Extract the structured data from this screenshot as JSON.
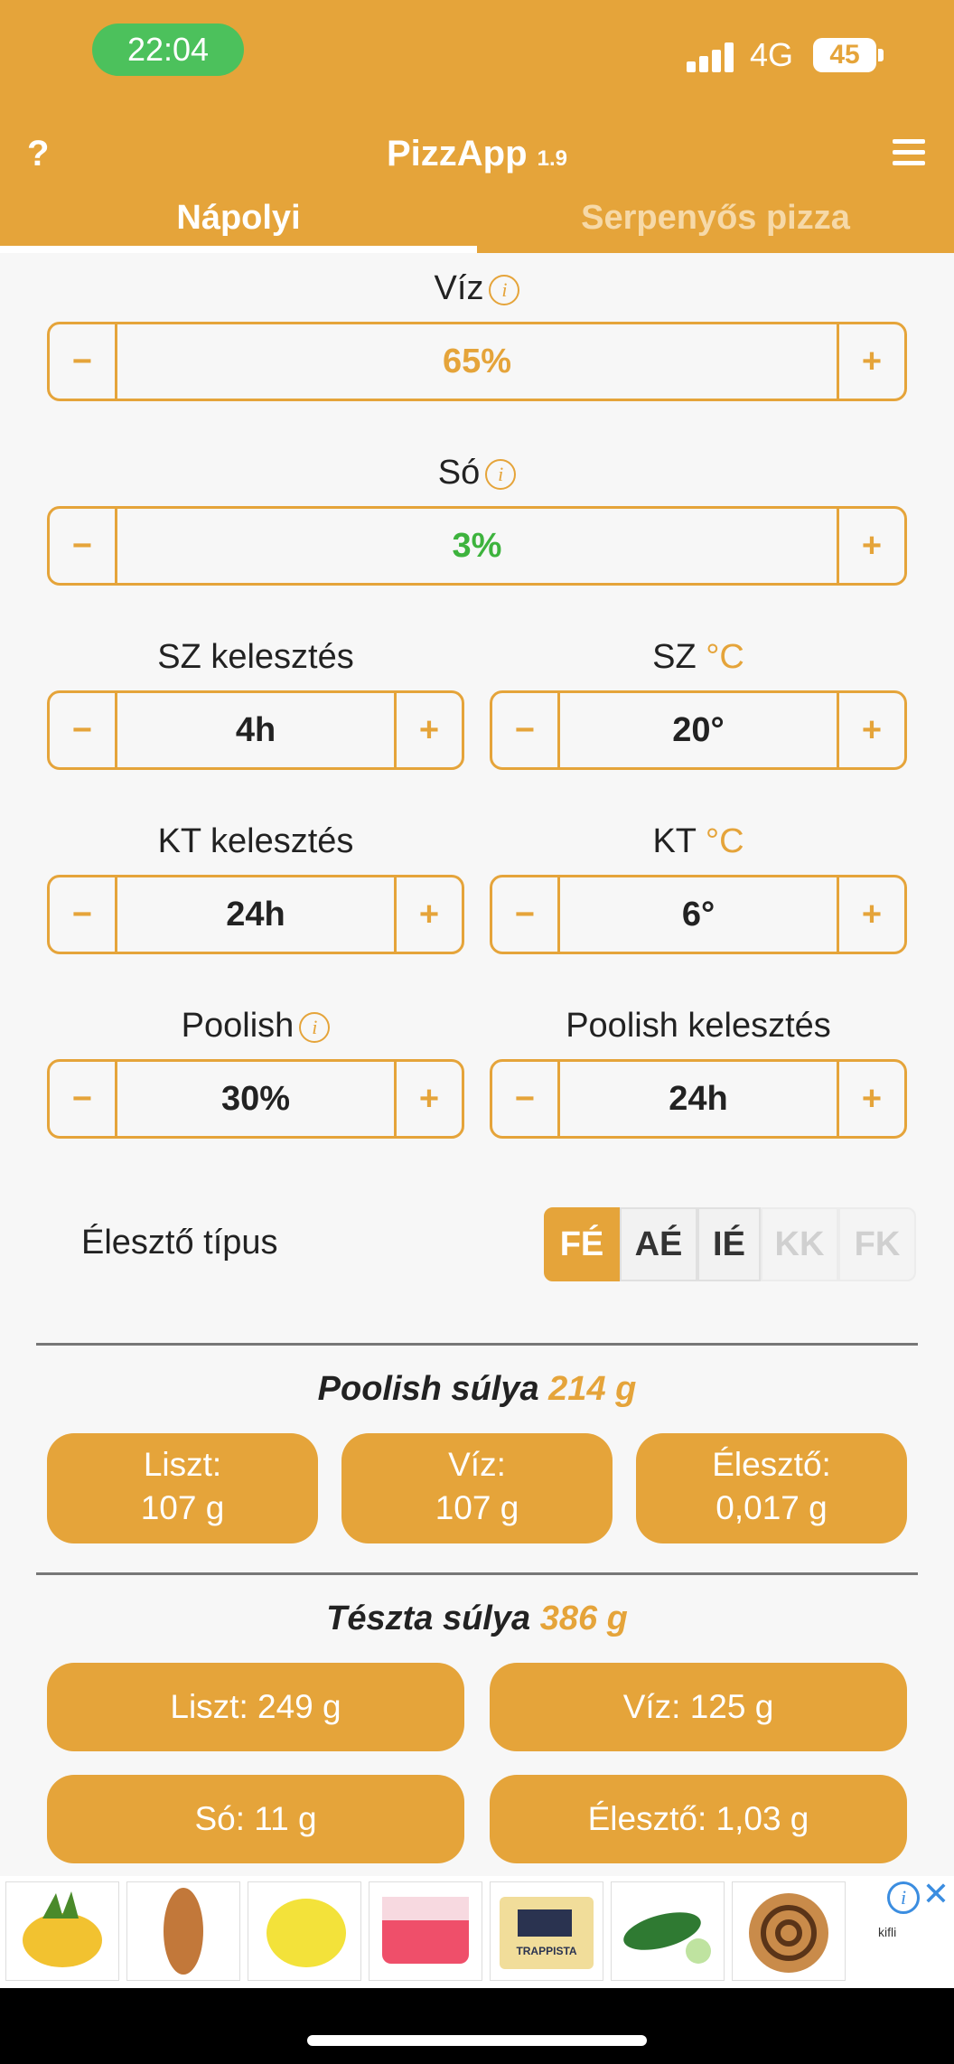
{
  "status_bar": {
    "time": "22:04",
    "network": "4G",
    "battery": "45"
  },
  "header": {
    "help": "?",
    "app_name": "PizzApp",
    "version": "1.9"
  },
  "tabs": [
    {
      "label": "Nápolyi",
      "active": true
    },
    {
      "label": "Serpenyős pizza",
      "active": false
    }
  ],
  "water": {
    "label": "Víz",
    "value": "65%"
  },
  "salt": {
    "label": "Só",
    "value": "3%"
  },
  "sz_rise": {
    "label": "SZ kelesztés",
    "value": "4h"
  },
  "sz_temp": {
    "label": "SZ",
    "unit": "°C",
    "value": "20°"
  },
  "kt_rise": {
    "label": "KT kelesztés",
    "value": "24h"
  },
  "kt_temp": {
    "label": "KT",
    "unit": "°C",
    "value": "6°"
  },
  "poolish": {
    "label": "Poolish",
    "value": "30%"
  },
  "poolish_rise": {
    "label": "Poolish kelesztés",
    "value": "24h"
  },
  "stepper": {
    "minus": "−",
    "plus": "+"
  },
  "info_glyph": "i",
  "yeast": {
    "label": "Élesztő típus",
    "options": [
      {
        "label": "FÉ",
        "state": "active"
      },
      {
        "label": "AÉ",
        "state": "normal"
      },
      {
        "label": "IÉ",
        "state": "normal"
      },
      {
        "label": "KK",
        "state": "disabled"
      },
      {
        "label": "FK",
        "state": "disabled"
      }
    ]
  },
  "poolish_weight": {
    "title": "Poolish súlya",
    "amount": "214 g",
    "items": [
      {
        "label": "Liszt:",
        "value": "107 g"
      },
      {
        "label": "Víz:",
        "value": "107 g"
      },
      {
        "label": "Élesztő:",
        "value": "0,017 g"
      }
    ]
  },
  "dough_weight": {
    "title": "Tészta súlya",
    "amount": "386 g",
    "items": [
      "Liszt: 249 g",
      "Víz: 125 g",
      "Só: 11 g",
      "Élesztő: 1,03 g"
    ]
  },
  "ad": {
    "product_text": "kifli",
    "brand_text": "TRAPPISTA"
  },
  "colors": {
    "accent": "#e5a43a",
    "salt_green": "#3db33d",
    "time_green": "#4cc15c"
  }
}
